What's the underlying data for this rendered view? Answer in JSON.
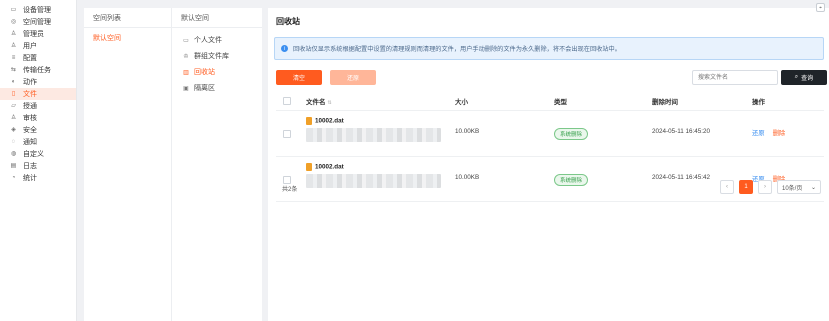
{
  "nav": {
    "items": [
      {
        "label": "设备管理",
        "icon": "monitor-icon",
        "glyph": "▭"
      },
      {
        "label": "空间管理",
        "icon": "space-icon",
        "glyph": "◎"
      },
      {
        "label": "管理员",
        "icon": "admin-icon",
        "glyph": "♙"
      },
      {
        "label": "用户",
        "icon": "user-icon",
        "glyph": "♙"
      },
      {
        "label": "配置",
        "icon": "config-icon",
        "glyph": "≡"
      },
      {
        "label": "传输任务",
        "icon": "transfer-icon",
        "glyph": "⇆"
      },
      {
        "label": "动作",
        "icon": "action-icon",
        "glyph": "◐"
      },
      {
        "label": "文件",
        "icon": "file-icon",
        "glyph": "▯"
      },
      {
        "label": "授通",
        "icon": "authorize-icon",
        "glyph": "▱"
      },
      {
        "label": "审核",
        "icon": "audit-icon",
        "glyph": "♙"
      },
      {
        "label": "安全",
        "icon": "shield-icon",
        "glyph": "◈"
      },
      {
        "label": "通知",
        "icon": "bell-icon",
        "glyph": "◌"
      },
      {
        "label": "自定义",
        "icon": "custom-icon",
        "glyph": "◍"
      },
      {
        "label": "日志",
        "icon": "log-icon",
        "glyph": "▤"
      },
      {
        "label": "统计",
        "icon": "chart-icon",
        "glyph": "◔"
      }
    ]
  },
  "space_list": {
    "title": "空间列表",
    "selected": "默认空间"
  },
  "default_space": {
    "title": "默认空间",
    "items": [
      {
        "label": "个人文件",
        "icon": "folder-icon",
        "glyph": "▭"
      },
      {
        "label": "群组文件库",
        "icon": "group-icon",
        "glyph": "♔"
      },
      {
        "label": "回收站",
        "icon": "trash-icon",
        "glyph": "▥"
      },
      {
        "label": "隔离区",
        "icon": "isolation-icon",
        "glyph": "▣"
      }
    ]
  },
  "main": {
    "title": "回收站",
    "notice": "回收站仅显示系统根据配置中设置的清理规则而清理的文件，用户手动删除的文件为永久删除，将不会出现在回收站中。",
    "clear_label": "清空",
    "restore_label": "还原",
    "search_placeholder": "搜索文件名",
    "query_label": "查询",
    "columns": {
      "name": "文件名",
      "size": "大小",
      "type": "类型",
      "time": "删除时间",
      "op": "操作"
    },
    "rows": [
      {
        "name": "10002.dat",
        "size": "10.00KB",
        "type": "系统删除",
        "time": "2024-05-11 16:45:20",
        "restore": "还原",
        "delete": "删除"
      },
      {
        "name": "10002.dat",
        "size": "10.00KB",
        "type": "系统删除",
        "time": "2024-05-11 16:45:42",
        "restore": "还原",
        "delete": "删除"
      }
    ],
    "total": "共2条",
    "page": "1",
    "page_size": "10条/页"
  },
  "colors": {
    "accent": "#ff5b1f",
    "dark": "#1f2429",
    "info": "#3b8ff0",
    "success": "#3aa14e"
  }
}
